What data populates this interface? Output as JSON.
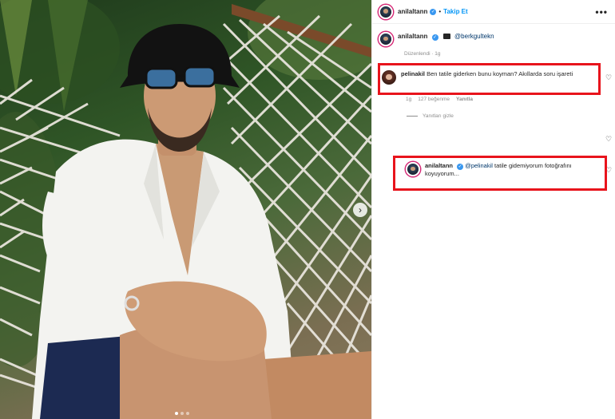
{
  "post": {
    "username": "anilaltann",
    "follow_label": "Takip Et",
    "more_label": "•••",
    "caption": {
      "username": "anilaltann",
      "mention": "@berkgultekn"
    },
    "edited_label": "Düzenlendi · 1g"
  },
  "comments": [
    {
      "username": "pelinakil",
      "text": "Ben tatile giderken bunu koyman? Akıllarda soru işareti",
      "meta": {
        "time": "1g",
        "likes": "127 beğenme",
        "reply": "Yanıtla"
      },
      "hide_replies": "Yanıtları gizle"
    },
    {
      "username": "anilaltann",
      "mention": "@pelinakil",
      "text": "tatile gidemiyorum fotoğrafını koyuyorum..."
    }
  ],
  "icons": {
    "next": "chevron-right-icon",
    "heart": "heart-icon",
    "verified": "verified-badge-icon",
    "clapper": "clapper-board-icon"
  },
  "colors": {
    "highlight": "#e8141c",
    "link": "#0095f6",
    "verified": "#3897f0",
    "muted": "#8e8e8e"
  },
  "carousel": {
    "count": 3,
    "active": 1
  }
}
